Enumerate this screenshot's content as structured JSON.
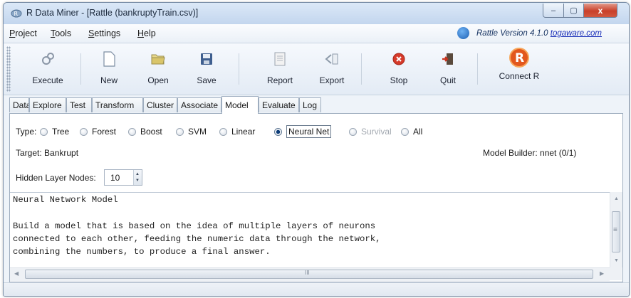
{
  "window": {
    "title": "R Data Miner - [Rattle (bankruptyTrain.csv)]",
    "controls": {
      "minimize": "–",
      "maximize": "▢",
      "close": "x"
    }
  },
  "menu": {
    "items": [
      {
        "label": "Project",
        "key": "P"
      },
      {
        "label": "Tools",
        "key": "T"
      },
      {
        "label": "Settings",
        "key": "S"
      },
      {
        "label": "Help",
        "key": "H"
      }
    ],
    "version_text": "Rattle Version 4.1.0",
    "version_link": "togaware.com"
  },
  "toolbar": {
    "buttons": [
      {
        "label": "Execute",
        "icon": "execute-icon"
      },
      {
        "label": "New",
        "icon": "new-document-icon"
      },
      {
        "label": "Open",
        "icon": "open-folder-icon"
      },
      {
        "label": "Save",
        "icon": "save-disk-icon"
      },
      {
        "label": "Report",
        "icon": "report-icon"
      },
      {
        "label": "Export",
        "icon": "export-icon"
      },
      {
        "label": "Stop",
        "icon": "stop-icon"
      },
      {
        "label": "Quit",
        "icon": "quit-door-icon"
      },
      {
        "label": "Connect R",
        "icon": "r-logo-icon"
      }
    ]
  },
  "tabs": {
    "items": [
      "Data",
      "Explore",
      "Test",
      "Transform",
      "Cluster",
      "Associate",
      "Model",
      "Evaluate",
      "Log"
    ],
    "active": "Model"
  },
  "model": {
    "type_label": "Type:",
    "types": [
      "Tree",
      "Forest",
      "Boost",
      "SVM",
      "Linear",
      "Neural Net",
      "Survival",
      "All"
    ],
    "selected_type": "Neural Net",
    "disabled_type": "Survival",
    "target_text": "Target: Bankrupt",
    "builder_text": "Model Builder:  nnet (0/1)",
    "hidden_layer_label": "Hidden Layer Nodes:",
    "hidden_layer_value": "10"
  },
  "textview": {
    "lines": [
      "Neural Network Model",
      "",
      "Build a model that is based on the idea of multiple layers of neurons",
      "connected to each other, feeding the numeric data through the network,",
      "combining the numbers, to produce a final answer."
    ]
  },
  "scroll": {
    "h_grip": "III",
    "v_grip": "≡"
  },
  "colors": {
    "title_bar": "#c3d6ee",
    "close_button": "#c9402a",
    "stop_red": "#d63a2a",
    "r_logo_orange": "#e2571d"
  }
}
